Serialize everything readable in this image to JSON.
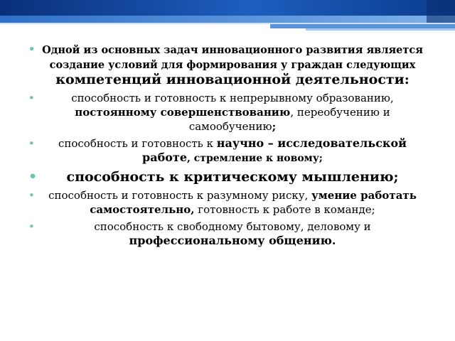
{
  "colors": {
    "banner_dark": "#0b3b8c",
    "banner_light": "#4f8fd6",
    "bullet": "#6fc2b0"
  },
  "icons": {
    "bullet": "bullet-icon"
  },
  "items": [
    {
      "a": "Одной из основных задач инновационного развития является создание условий для формирования у граждан следующих ",
      "b": "компетенций инновационной деятельности:"
    },
    {
      "a": "способность и готовность к непрерывному образованию, ",
      "b": "постоянному совершенствованию",
      "c": ", переобучению и самообучению",
      "d": ";"
    },
    {
      "a": "способность и готовность к ",
      "b": "научно – исследовательской работе",
      "c": ", стремление к новому;"
    },
    {
      "a": "способность к критическому мышлению;"
    },
    {
      "a": "способность и готовность к разумному риску, ",
      "b": "умение работать самостоятельно,",
      "c": " готовность к работе в команде;"
    },
    {
      "a": "способность к свободному бытовому, деловому и ",
      "b": "профессиональному общению."
    }
  ]
}
